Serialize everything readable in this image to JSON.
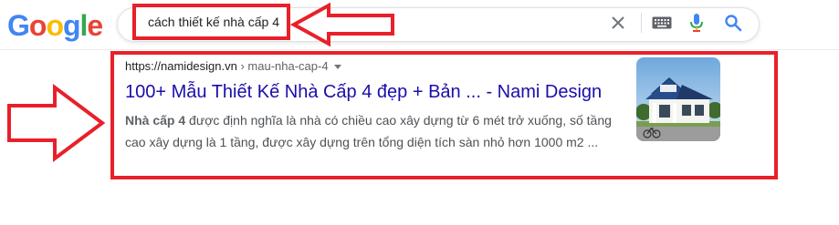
{
  "logo": {
    "letters": [
      "G",
      "o",
      "o",
      "g",
      "l",
      "e"
    ],
    "colors": [
      "#4285f4",
      "#ea4335",
      "#fbbc05",
      "#4285f4",
      "#34a853",
      "#ea4335"
    ]
  },
  "search": {
    "query": "cách thiết kế nhà cấp 4",
    "icons": [
      "clear-icon",
      "keyboard-icon",
      "mic-icon",
      "search-icon"
    ]
  },
  "result": {
    "url_domain": "https://namidesign.vn",
    "url_path": " › mau-nha-cap-4",
    "title": "100+ Mẫu Thiết Kế Nhà Cấp 4 đẹp + Bản ... - Nami Design",
    "snippet_bold": "Nhà cấp 4",
    "snippet_rest": " được định nghĩa là nhà có chiều cao xây dựng từ 6 mét trở xuống, số tầng cao xây dựng là 1 tầng, được xây dựng trên tổng diện tích sàn nhỏ hơn 1000 m2 ...",
    "thumbnail": "house-thumbnail"
  },
  "annotations": {
    "highlight_color": "#e8202a"
  }
}
